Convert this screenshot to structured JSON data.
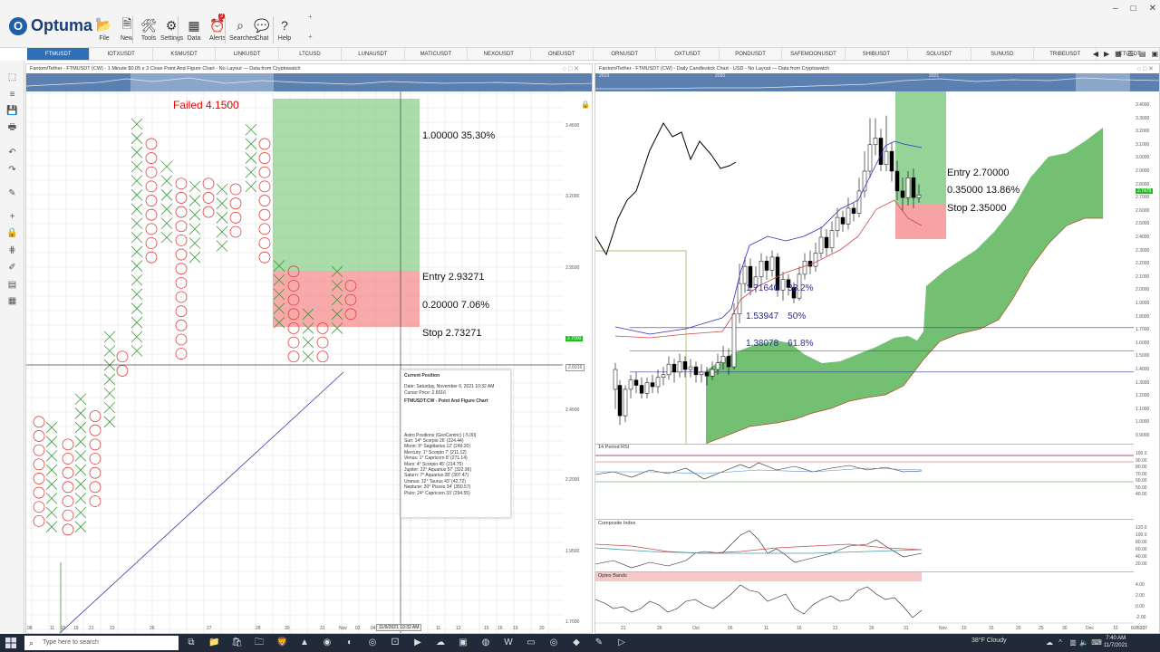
{
  "ribbon": {
    "brand": "Optuma",
    "buttons": [
      {
        "label": "File",
        "icon": "folder-icon"
      },
      {
        "label": "New",
        "icon": "new-document-icon"
      },
      {
        "label": "Tools",
        "icon": "tools-icon"
      },
      {
        "label": "Settings",
        "icon": "gear-icon"
      },
      {
        "label": "Data",
        "icon": "binary-data-icon"
      },
      {
        "label": "Alerts",
        "icon": "alarm-clock-icon",
        "badge": "2"
      },
      {
        "label": "Searches",
        "icon": "search-icon"
      },
      {
        "label": "Chat",
        "icon": "chat-icon"
      },
      {
        "label": "Help",
        "icon": "help-icon"
      }
    ],
    "window_controls": [
      "–",
      "□",
      "✕"
    ]
  },
  "symbol_tabs": [
    "FTMUSDT",
    "IOTXUSDT",
    "KSMUSDT",
    "LINKUSDT",
    "LTCUSD",
    "LUNAUSDT",
    "MATICUSDT",
    "NEXOUSDT",
    "ONEUSDT",
    "ORNUSDT",
    "OXTUSDT",
    "PONDUSDT",
    "SAFEMOONUSDT",
    "SHIBUSDT",
    "SOLUSDT",
    "SUNUSD",
    "TRIBEUSDT",
    "VETUSDT"
  ],
  "left_chart": {
    "title": "Fantom/Tether - FTMUSDT (CW) - 1 Minute $0.05 x 3 Close Point And Figure Chart - No Layout — Data from Cryptowatch",
    "failed_label": "Failed 4.1500",
    "target_text": "1.00000   35.30%",
    "entry_text": "Entry   2.93271",
    "risk_text": "0.20000   7.06%",
    "stop_text": "Stop   2.73271",
    "price_axis": [
      "3.4500",
      "3.2000",
      "2.9500",
      "2.7000",
      "2.6016",
      "2.4500",
      "2.2000",
      "1.9500",
      "1.7000"
    ],
    "last_price": "2.7000",
    "cursor_price": "2.6016",
    "date_axis": [
      "08",
      "11",
      "15",
      "19",
      "21",
      "23",
      "26",
      "27",
      "28",
      "30",
      "31",
      "Nov",
      "02",
      "04",
      "08",
      "09",
      "11",
      "12",
      "15",
      "16",
      "19",
      "20"
    ],
    "cursor_date": "11/6/2021 10:32 AM"
  },
  "tooltip": {
    "heading": "Current Position",
    "date": "Date: Saturday, November 6, 2021 10:32 AM",
    "cursor": "Cursor Price: 2.6016",
    "chart": "FTMUSDT:CW - Point And Figure Chart",
    "astro_title": "Astro Positions (GeoCentric) (-5.00)",
    "astro": [
      "Sun: 14° Scorpio 26' (224.44)",
      "Moon: 9° Sagittarius 12' (249.20)",
      "Mercury: 1° Scorpio 7' (211.12)",
      "Venus: 1° Capricorn 8' (271.14)",
      "Mars: 4° Scorpio 45' (214.75)",
      "Jupiter: 22° Aquarius 57' (322.96)",
      "Saturn: 7° Aquarius 28' (307.47)",
      "Uranus: 12° Taurus 43' (42.72)",
      "Neptune: 20° Pisces 34' (350.57)",
      "Pluto: 24° Capricorn 33' (294.55)"
    ]
  },
  "right_chart": {
    "title": "Fantom/Tether - FTMUSDT (CW) - Daily Candlestick Chart - USD - No Layout — Data from Cryptowatch",
    "overview_years": [
      "2019",
      "2020",
      "2021"
    ],
    "entry_text": "Entry   2.70000",
    "risk_text": "0.35000   13.86%",
    "stop_text": "Stop   2.35000",
    "fib_levels": [
      {
        "price": "1.71640",
        "pct": "38.2%"
      },
      {
        "price": "1.53947",
        "pct": "50%"
      },
      {
        "price": "1.38078",
        "pct": "61.8%"
      }
    ],
    "price_axis": [
      "3.4000",
      "3.3000",
      "3.2000",
      "3.1000",
      "3.0000",
      "2.9000",
      "2.8000",
      "2.7000",
      "2.6000",
      "2.5000",
      "2.4000",
      "2.3000",
      "2.2000",
      "2.1000",
      "2.0000",
      "1.9000",
      "1.8000",
      "1.7000",
      "1.6000",
      "1.5000",
      "1.4000",
      "1.3000",
      "1.2000",
      "1.1000",
      "1.0000",
      "0.9000"
    ],
    "last_price": "2.7475",
    "date_axis": [
      "21",
      "26",
      "Oct",
      "06",
      "11",
      "16",
      "21",
      "26",
      "31",
      "Nov",
      "10",
      "15",
      "20",
      "25",
      "30",
      "Dec",
      "10"
    ]
  },
  "rsi": {
    "title": "14 Period RSI",
    "axis": [
      "100.0",
      "90.00",
      "80.00",
      "70.00",
      "60.00",
      "50.00",
      "40.00"
    ]
  },
  "composite": {
    "title": "Composite Index",
    "axis": [
      "120.0",
      "100.0",
      "80.00",
      "60.00",
      "40.00",
      "20.00"
    ]
  },
  "optex": {
    "title": "Optex Bands",
    "axis": [
      "4.00",
      "2.00",
      "0.00",
      "-2.00"
    ]
  },
  "status_value": "0.05337",
  "taskbar": {
    "search_placeholder": "Type here to search",
    "weather": "38°F  Cloudy",
    "time": "7:40 AM",
    "date": "11/7/2021"
  }
}
